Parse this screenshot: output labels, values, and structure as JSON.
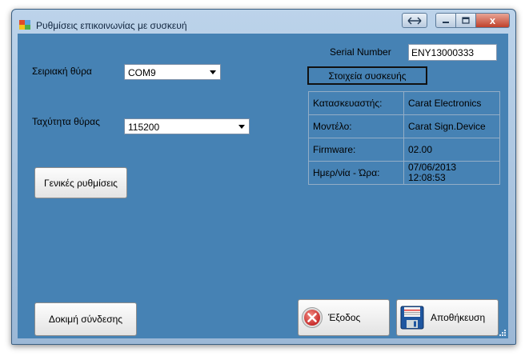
{
  "window": {
    "title": "Ρυθμίσεις επικοινωνίας με συσκευή",
    "close_glyph": "x"
  },
  "serial_port": {
    "label": "Σειριακή θύρα",
    "value": "COM9"
  },
  "baud_rate": {
    "label": "Ταχύτητα θύρας",
    "value": "115200"
  },
  "buttons": {
    "general_settings": "Γενικές ρυθμίσεις",
    "test_connection": "Δοκιμή σύνδεσης",
    "exit": "Έξοδος",
    "save": "Αποθήκευση"
  },
  "serial_number": {
    "label": "Serial Number",
    "value": "ENY13000333"
  },
  "device_info": {
    "title": "Στοιχεία συσκευής",
    "rows": [
      {
        "label": "Κατασκευαστής:",
        "value": "Carat Electronics"
      },
      {
        "label": "Μοντέλο:",
        "value": "Carat Sign.Device"
      },
      {
        "label": "Firmware:",
        "value": "02.00"
      },
      {
        "label": "Ημερ/νία - Ώρα:",
        "value": "07/06/2013\n12:08:53"
      }
    ]
  },
  "colors": {
    "client_background": "#4682b4",
    "exit_icon_red": "#d32f2f",
    "save_icon_blue": "#1e56a0"
  },
  "icons": [
    "app-icon",
    "restore-arrows-icon",
    "minimize-icon",
    "maximize-icon",
    "close-icon",
    "exit-x-icon",
    "floppy-disk-icon",
    "resize-grip-icon"
  ]
}
